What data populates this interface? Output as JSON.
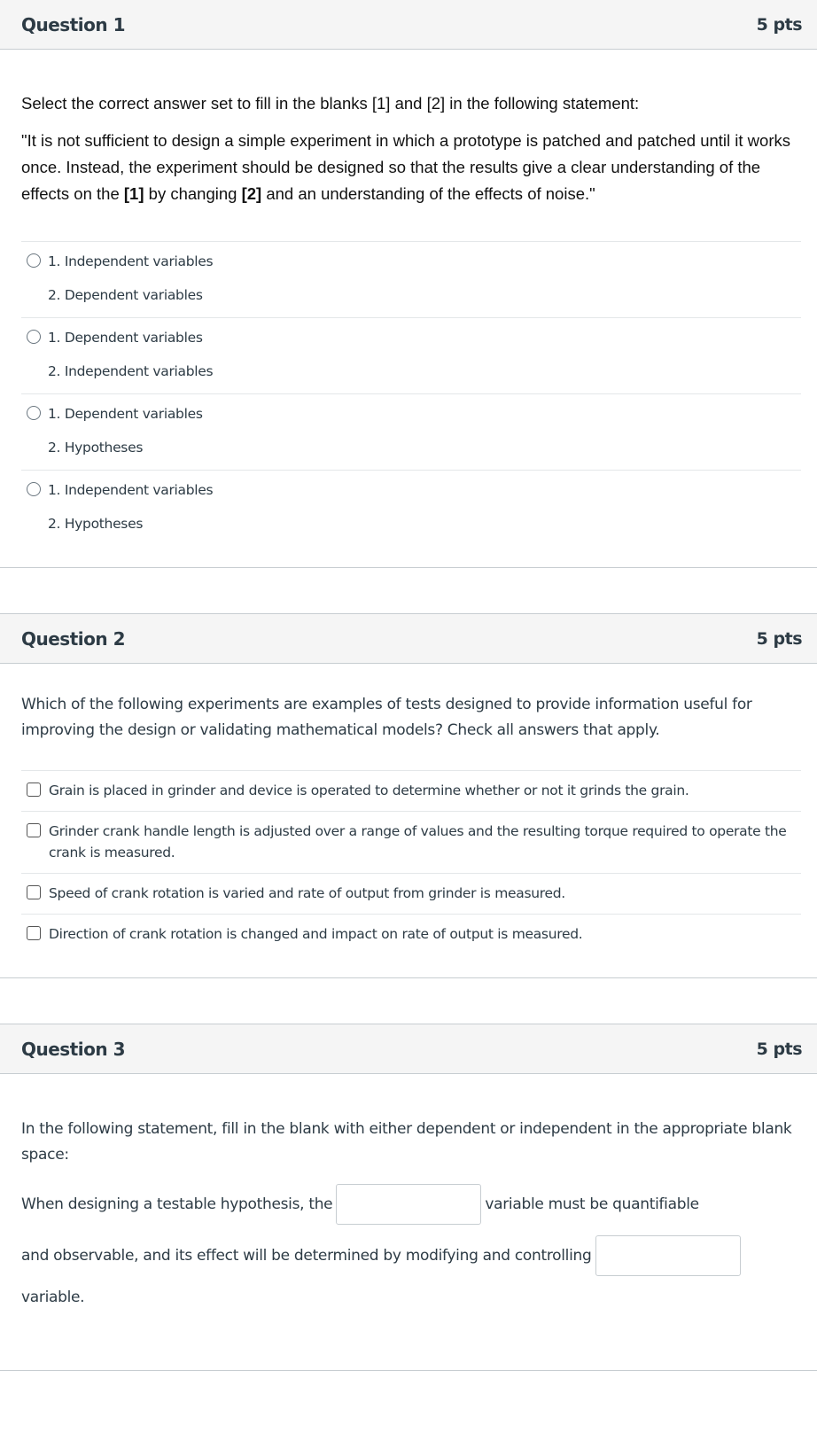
{
  "questions": [
    {
      "title": "Question 1",
      "points": "5 pts",
      "type": "multiple-choice",
      "prompt_intro": "Select the correct answer set to fill in the blanks [1] and [2] in the following statement:",
      "quote_part1": "\"It is not sufficient to design a simple experiment in which a prototype is patched and patched until it works once. Instead, the experiment should be designed so that the results give a clear understanding of the effects on the ",
      "blank1": "[1]",
      "quote_part2": " by changing ",
      "blank2": "[2]",
      "quote_part3": " and an understanding of the effects of noise.\"",
      "options": [
        {
          "line1": "1. Independent variables",
          "line2": "2. Dependent variables",
          "selected": false
        },
        {
          "line1": "1. Dependent variables",
          "line2": "2. Independent variables",
          "selected": false
        },
        {
          "line1": "1. Dependent variables",
          "line2": "2. Hypotheses",
          "selected": false
        },
        {
          "line1": "1. Independent variables",
          "line2": "2. Hypotheses",
          "selected": false
        }
      ]
    },
    {
      "title": "Question 2",
      "points": "5 pts",
      "type": "multiple-answer",
      "prompt": "Which of the following experiments are examples of tests designed to provide information useful for improving the design or validating mathematical models? Check all answers that apply.",
      "options": [
        {
          "label": "Grain is placed in grinder and device is operated to determine whether or not it grinds the grain.",
          "checked": false
        },
        {
          "label": "Grinder crank handle length is adjusted over a range of values and the resulting torque required to operate the crank is measured.",
          "checked": false
        },
        {
          "label": "Speed of crank rotation is varied and rate of output from grinder is measured.",
          "checked": false
        },
        {
          "label": "Direction of crank rotation is changed and impact on rate of output is measured.",
          "checked": false
        }
      ]
    },
    {
      "title": "Question 3",
      "points": "5 pts",
      "type": "fill-in-multiple-blanks",
      "prompt": "In the following statement, fill in the blank with either dependent or independent in the appropriate blank space:",
      "segment1": "When designing a testable hypothesis, the",
      "blank1_value": "",
      "segment2": "variable must be quantifiable",
      "segment3": "and observable, and its effect will be determined by modifying and controlling",
      "blank2_value": "",
      "segment4": "variable."
    }
  ]
}
